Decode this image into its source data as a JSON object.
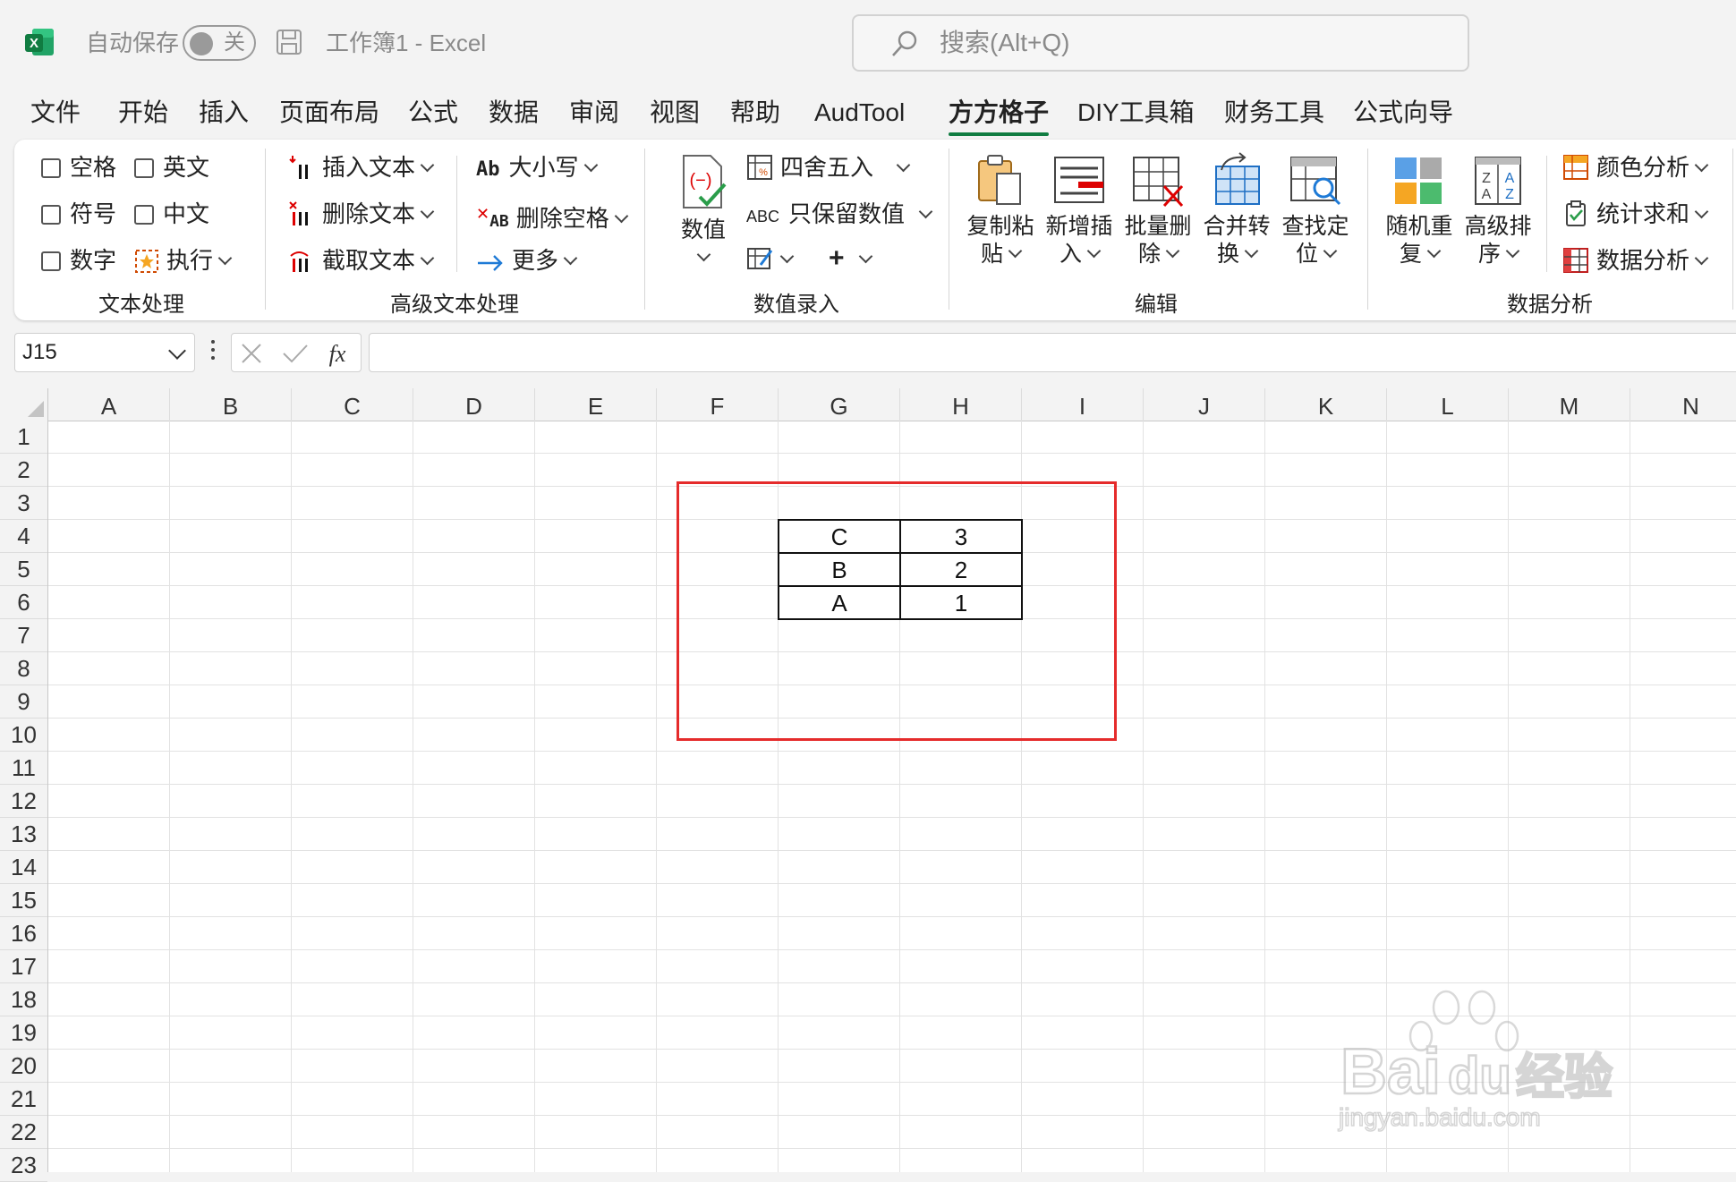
{
  "titlebar": {
    "autosave_label": "自动保存",
    "autosave_state": "关",
    "document_title": "工作簿1  -  Excel",
    "search_placeholder": "搜索(Alt+Q)"
  },
  "menu_tabs": [
    {
      "label": "文件"
    },
    {
      "label": "开始"
    },
    {
      "label": "插入"
    },
    {
      "label": "页面布局"
    },
    {
      "label": "公式"
    },
    {
      "label": "数据"
    },
    {
      "label": "审阅"
    },
    {
      "label": "视图"
    },
    {
      "label": "帮助"
    },
    {
      "label": "AudTool"
    },
    {
      "label": "方方格子",
      "active": true
    },
    {
      "label": "DIY工具箱"
    },
    {
      "label": "财务工具"
    },
    {
      "label": "公式向导"
    }
  ],
  "ribbon": {
    "text_group": {
      "checkboxes": [
        "空格",
        "英文",
        "符号",
        "中文",
        "数字"
      ],
      "execute": "执行",
      "label": "文本处理"
    },
    "advanced_text_group": {
      "insert_text": "插入文本",
      "delete_text": "删除文本",
      "extract_text": "截取文本",
      "case": "大小写",
      "case_icon": "Ab",
      "delete_space": "删除空格",
      "delete_space_icon": "AB",
      "more": "更多",
      "label": "高级文本处理"
    },
    "number_group": {
      "number": "数值",
      "round": "四舍五入",
      "keep_values": "只保留数值",
      "keep_values_icon": "ABC",
      "label": "数值录入"
    },
    "edit_group": {
      "buttons": [
        {
          "line1": "复制粘",
          "line2": "贴"
        },
        {
          "line1": "新增插",
          "line2": "入"
        },
        {
          "line1": "批量删",
          "line2": "除"
        },
        {
          "line1": "合并转",
          "line2": "换"
        },
        {
          "line1": "查找定",
          "line2": "位"
        }
      ],
      "label": "编辑"
    },
    "analysis_group": {
      "random": {
        "line1": "随机重",
        "line2": "复"
      },
      "sort": {
        "line1": "高级排",
        "line2": "序"
      },
      "color_analysis": "颜色分析",
      "stat_sum": "统计求和",
      "data_analysis": "数据分析",
      "label": "数据分析"
    }
  },
  "formula_bar": {
    "name_box": "J15",
    "formula": ""
  },
  "sheet": {
    "columns": [
      "A",
      "B",
      "C",
      "D",
      "E",
      "F",
      "G",
      "H",
      "I",
      "J",
      "K",
      "L",
      "M",
      "N"
    ],
    "rows": [
      "1",
      "2",
      "3",
      "4",
      "5",
      "6",
      "7",
      "8",
      "9",
      "10",
      "11",
      "12",
      "13",
      "14",
      "15",
      "16",
      "17",
      "18",
      "19",
      "20",
      "21",
      "22",
      "23"
    ],
    "cells": [
      {
        "ref": "G4",
        "value": "C"
      },
      {
        "ref": "H4",
        "value": "3"
      },
      {
        "ref": "G5",
        "value": "B"
      },
      {
        "ref": "H5",
        "value": "2"
      },
      {
        "ref": "G6",
        "value": "A"
      },
      {
        "ref": "H6",
        "value": "1"
      }
    ]
  },
  "watermark": {
    "brand": "Bai",
    "brand2": "du",
    "cn": "经验",
    "url": "jingyan.baidu.com"
  },
  "colors": {
    "excel_green": "#107c41",
    "highlight_red": "#e52b2b"
  }
}
